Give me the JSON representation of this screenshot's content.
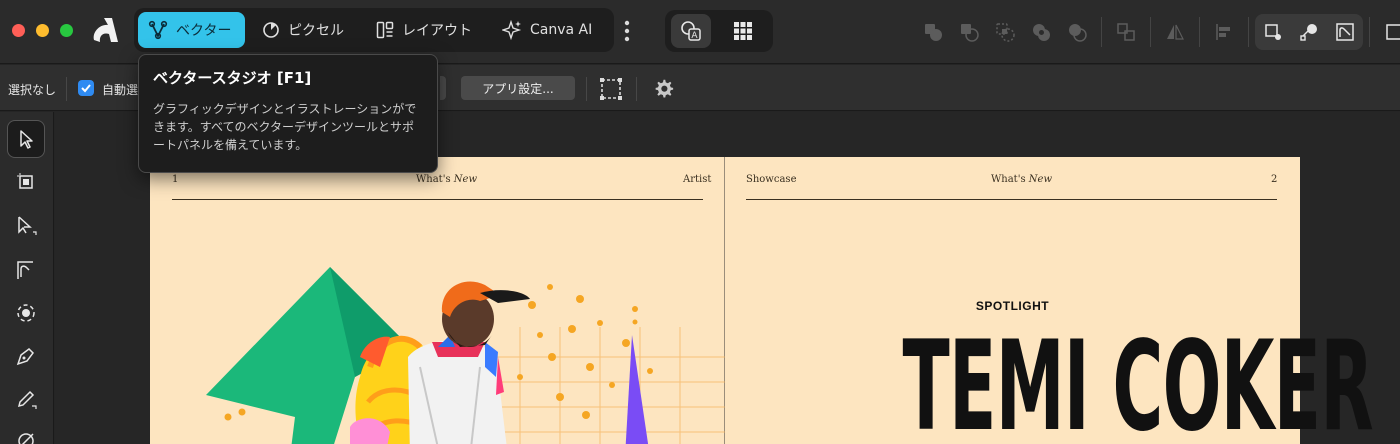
{
  "titlebar": {
    "studios": [
      {
        "label": "ベクター",
        "icon": "vector-pen-icon",
        "active": true
      },
      {
        "label": "ピクセル",
        "icon": "pixel-circle-icon",
        "active": false
      },
      {
        "label": "レイアウト",
        "icon": "layout-columns-icon",
        "active": false
      },
      {
        "label": "Canva AI",
        "icon": "sparkle-icon",
        "active": false
      }
    ],
    "personas": [
      {
        "icon": "shape-text-persona-icon",
        "active": true
      },
      {
        "icon": "grid-persona-icon",
        "active": false
      }
    ]
  },
  "contextbar": {
    "selection_label": "選択なし",
    "auto_label": "自動選",
    "auto_checked": true,
    "app_settings_label": "アプリ設定..."
  },
  "tooltip": {
    "title": "ベクタースタジオ [F1]",
    "body": "グラフィックデザインとイラストレーションができます。すべてのベクターデザインツールとサポートパネルを備えています。"
  },
  "document": {
    "left_page": {
      "number": "1",
      "running_title": "What's",
      "running_title_italic": "New",
      "section": "Artist"
    },
    "right_page": {
      "section": "Showcase",
      "running_title": "What's",
      "running_title_italic": "New",
      "number": "2"
    },
    "spotlight": "SPOTLIGHT",
    "headline": "TEMI COKER"
  },
  "colors": {
    "accent_studio": "#33c3ea",
    "page_bg": "#fde5c0",
    "checkbox": "#2f8bf2"
  }
}
